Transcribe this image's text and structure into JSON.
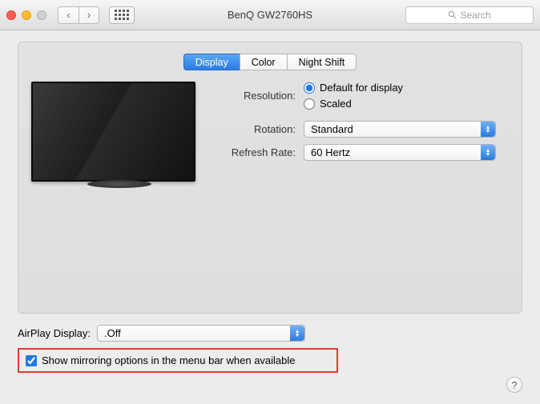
{
  "window": {
    "title": "BenQ GW2760HS",
    "search_placeholder": "Search"
  },
  "tabs": {
    "display": "Display",
    "color": "Color",
    "night_shift": "Night Shift"
  },
  "labels": {
    "resolution": "Resolution:",
    "rotation": "Rotation:",
    "refresh_rate": "Refresh Rate:",
    "airplay": "AirPlay Display:"
  },
  "resolution": {
    "default": "Default for display",
    "scaled": "Scaled"
  },
  "rotation_value": "Standard",
  "refresh_rate_value": "60 Hertz",
  "airplay_value": ".Off",
  "mirroring_checkbox": "Show mirroring options in the menu bar when available",
  "help_label": "?"
}
